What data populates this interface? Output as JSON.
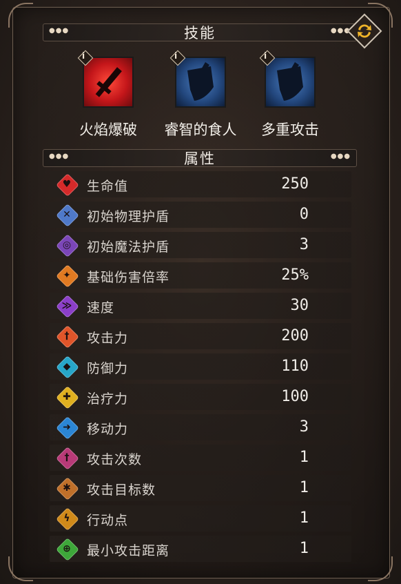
{
  "skills_section": {
    "title": "技能"
  },
  "skills": [
    {
      "name": "火焰爆破",
      "color": "#d31b1b",
      "icon": "sword-icon",
      "tag_icon": "info-icon"
    },
    {
      "name": "睿智的食人",
      "color": "#2a4f88",
      "icon": "shield-icon",
      "tag_icon": "info-icon"
    },
    {
      "name": "多重攻击",
      "color": "#2a4f88",
      "icon": "shield-icon",
      "tag_icon": "info-icon"
    }
  ],
  "attributes_section": {
    "title": "属性"
  },
  "attributes": [
    {
      "label": "生命值",
      "value": "250",
      "icon": "heart-icon",
      "color": "#d42a2a"
    },
    {
      "label": "初始物理护盾",
      "value": "0",
      "icon": "physical-shield-icon",
      "color": "#4f79c9"
    },
    {
      "label": "初始魔法护盾",
      "value": "3",
      "icon": "magic-shield-icon",
      "color": "#7b46b8"
    },
    {
      "label": "基础伤害倍率",
      "value": "25%",
      "icon": "damage-multiplier-icon",
      "color": "#e07a22"
    },
    {
      "label": "速度",
      "value": "30",
      "icon": "speed-icon",
      "color": "#8b3fc9"
    },
    {
      "label": "攻击力",
      "value": "200",
      "icon": "attack-icon",
      "color": "#e0552a"
    },
    {
      "label": "防御力",
      "value": "110",
      "icon": "defense-icon",
      "color": "#27a6c9"
    },
    {
      "label": "治疗力",
      "value": "100",
      "icon": "heal-icon",
      "color": "#e0b020"
    },
    {
      "label": "移动力",
      "value": "3",
      "icon": "move-icon",
      "color": "#2b86d4"
    },
    {
      "label": "攻击次数",
      "value": "1",
      "icon": "attack-count-icon",
      "color": "#b83a78"
    },
    {
      "label": "攻击目标数",
      "value": "1",
      "icon": "target-count-icon",
      "color": "#c0702a"
    },
    {
      "label": "行动点",
      "value": "1",
      "icon": "action-point-icon",
      "color": "#d08a1a"
    },
    {
      "label": "最小攻击距离",
      "value": "1",
      "icon": "range-icon",
      "color": "#3ea83a"
    }
  ],
  "swap_button": {
    "icon": "swap-arrows-icon"
  },
  "accent": "#e7d8c2"
}
